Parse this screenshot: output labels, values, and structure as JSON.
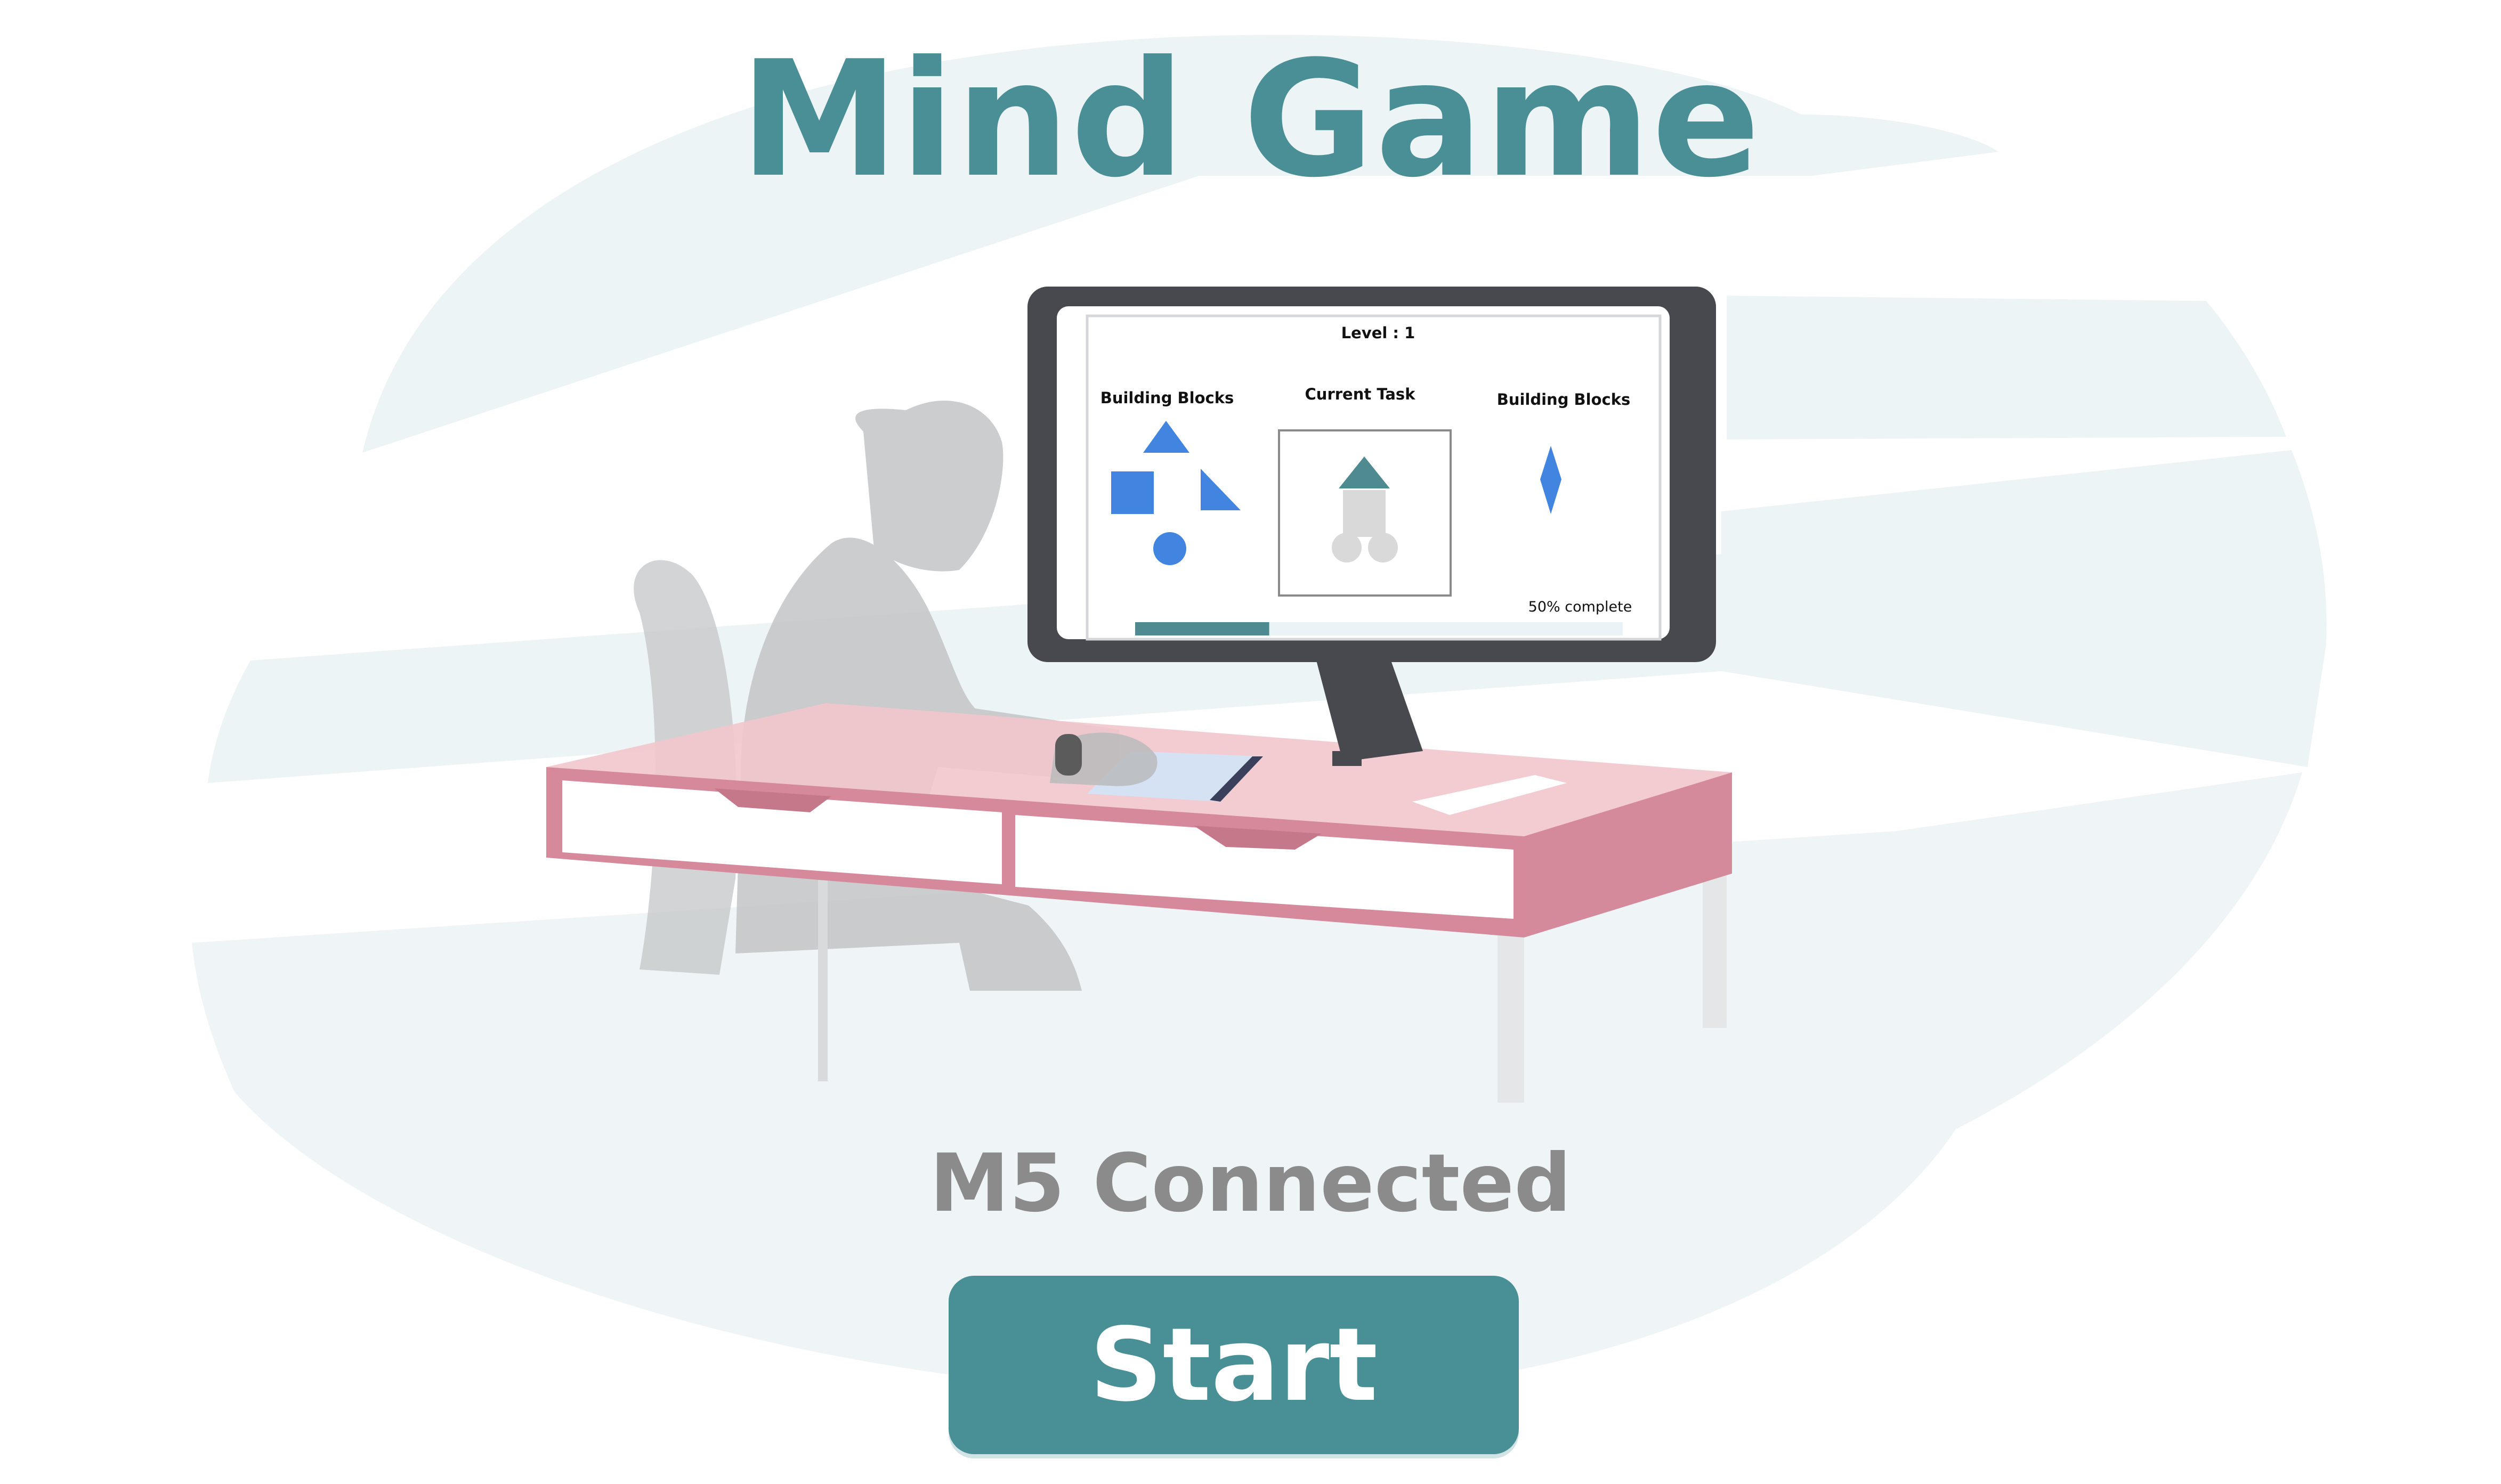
{
  "app": {
    "title": "Mind Game"
  },
  "illustration": {
    "screen": {
      "level_label": "Level : 1",
      "left_panel_title": "Building Blocks",
      "center_panel_title": "Current Task",
      "right_panel_title": "Building Blocks",
      "progress_label": "50% complete",
      "progress_fraction": 0.5
    }
  },
  "status": {
    "text": "M5 Connected"
  },
  "actions": {
    "start_label": "Start"
  },
  "colors": {
    "accent": "#488f96",
    "status_text": "#8b8b8b",
    "shape_blue": "#4185e0",
    "desk_pink": "#f2c6cd"
  }
}
